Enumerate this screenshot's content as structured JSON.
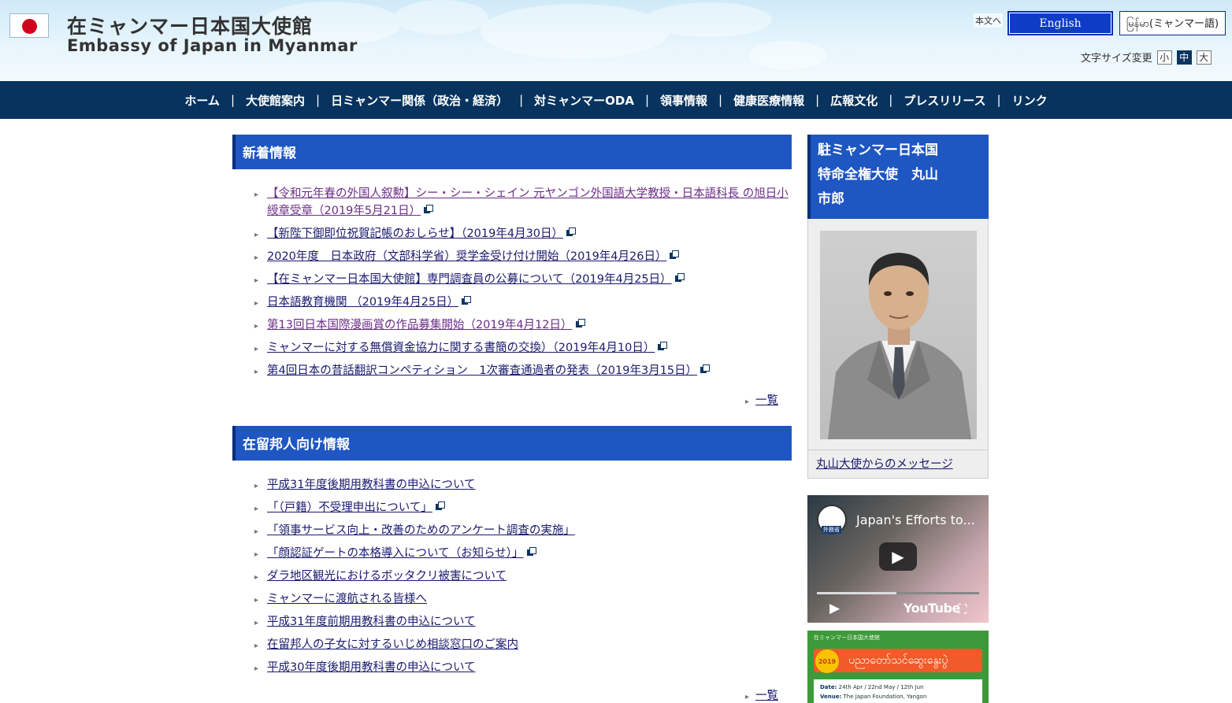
{
  "header": {
    "title_jp": "在ミャンマー日本国大使館",
    "title_en": "Embassy of Japan in Myanmar",
    "skip_link": "本文へ",
    "lang_english": "English",
    "lang_myanmar": "မြန်မာ(ミャンマー語)",
    "fontsize_label": "文字サイズ変更",
    "fontsize_small": "小",
    "fontsize_medium": "中",
    "fontsize_large": "大",
    "fontsize_selected": "中"
  },
  "nav": {
    "items": [
      "ホーム",
      "大使館案内",
      "日ミャンマー関係（政治・経済）",
      "対ミャンマーODA",
      "領事情報",
      "健康医療情報",
      "広報文化",
      "プレスリリース",
      "リンク"
    ],
    "separator": "|"
  },
  "news": {
    "heading": "新着情報",
    "items": [
      "【令和元年春の外国人叙勲】シー・シー・シェイン 元ヤンゴン外国語大学教授・日本語科長 の旭日小綬章受章（2019年5月21日）",
      "【新陛下御即位祝賀記帳のおしらせ】（2019年4月30日）",
      "2020年度　日本政府（文部科学省）奨学金受け付け開始（2019年4月26日）",
      "【在ミャンマー日本国大使館】専門調査員の公募について（2019年4月25日）",
      "日本語教育機関 （2019年4月25日）",
      "第13回日本国際漫画賞の作品募集開始（2019年4月12日）",
      "ミャンマーに対する無償資金協力に関する書簡の交換）（2019年4月10日）",
      "第4回日本の昔話翻訳コンペティション　1次審査通過者の発表（2019年3月15日）"
    ],
    "more": "一覧"
  },
  "residents": {
    "heading": "在留邦人向け情報",
    "items": [
      "平成31年度後期用教科書の申込について",
      "「（戸籍）不受理申出について」",
      "「領事サービス向上・改善のためのアンケート調査の実施」",
      "「顔認証ゲートの本格導入について（お知らせ）」",
      "ダラ地区観光におけるボッタクリ被害について",
      "ミャンマーに渡航される皆様へ",
      "平成31年度前期用教科書の申込について",
      "在留邦人の子女に対するいじめ相談窓口のご案内",
      "平成30年度後期用教科書の申込について"
    ],
    "more": "一覧"
  },
  "sidebar": {
    "ambassador_line1": "駐ミャンマー日本国",
    "ambassador_line2": "特命全権大使　丸山",
    "ambassador_line3": "市郎",
    "message_link": "丸山大使からのメッセージ",
    "video_title": "Japan's Efforts to...",
    "video_logo_text": "外務省",
    "video_brand": "YouTube",
    "video_progress": 0.49,
    "banner_top": "在ミャンマー日本国大使館",
    "banner_badge": "2019",
    "banner_title": "ပညာတော်သင်ဆွေးနွေးပွဲ",
    "banner_date_label": "Date:",
    "banner_date": "24th Apr / 22nd May / 12th Jun",
    "banner_venue_label": "Venue:",
    "banner_venue": "The Japan Foundation, Yangon"
  },
  "colors": {
    "nav_bg": "#07335e",
    "section_head": "#1e56c2",
    "link": "#1a1a6e",
    "visited_link": "#6b2d86"
  }
}
